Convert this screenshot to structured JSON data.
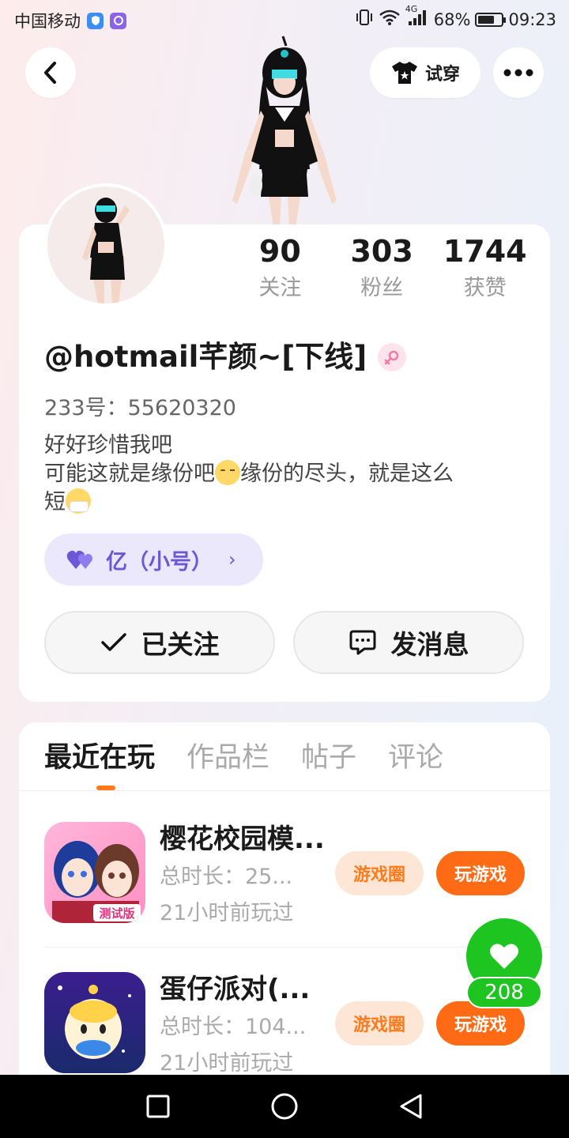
{
  "status_bar": {
    "carrier": "中国移动",
    "network": "4G",
    "battery": "68%",
    "battery_level": 0.68,
    "time": "09:23"
  },
  "header": {
    "try_on_label": "试穿"
  },
  "profile": {
    "stats": [
      {
        "value": "90",
        "label": "关注"
      },
      {
        "value": "303",
        "label": "粉丝"
      },
      {
        "value": "1744",
        "label": "获赞"
      }
    ],
    "username": "@hotmail芊颜~[下线]",
    "uid": "233号：55620320",
    "bio_line1": "好好珍惜我吧",
    "bio_line2_a": "可能这就是缘份吧",
    "bio_line2_b": "缘份的尽头，就是这么",
    "bio_line3": "短",
    "alt_account": "亿（小号）",
    "followed_label": "已关注",
    "message_label": "发消息"
  },
  "tabs": [
    "最近在玩",
    "作品栏",
    "帖子",
    "评论"
  ],
  "games": [
    {
      "title": "樱花校园模...",
      "total_time": "总时长：25...",
      "last_played": "21小时前玩过",
      "circle_label": "游戏圈",
      "play_label": "玩游戏",
      "icon_badge": "测试版"
    },
    {
      "title": "蛋仔派对(...",
      "total_time": "总时长：104...",
      "last_played": "21小时前玩过",
      "circle_label": "游戏圈",
      "play_label": "玩游戏"
    }
  ],
  "float_like": {
    "count": "208"
  },
  "colors": {
    "accent_orange": "#ff6a14",
    "like_green": "#1ec41f",
    "alt_purple": "#6c57d9"
  }
}
